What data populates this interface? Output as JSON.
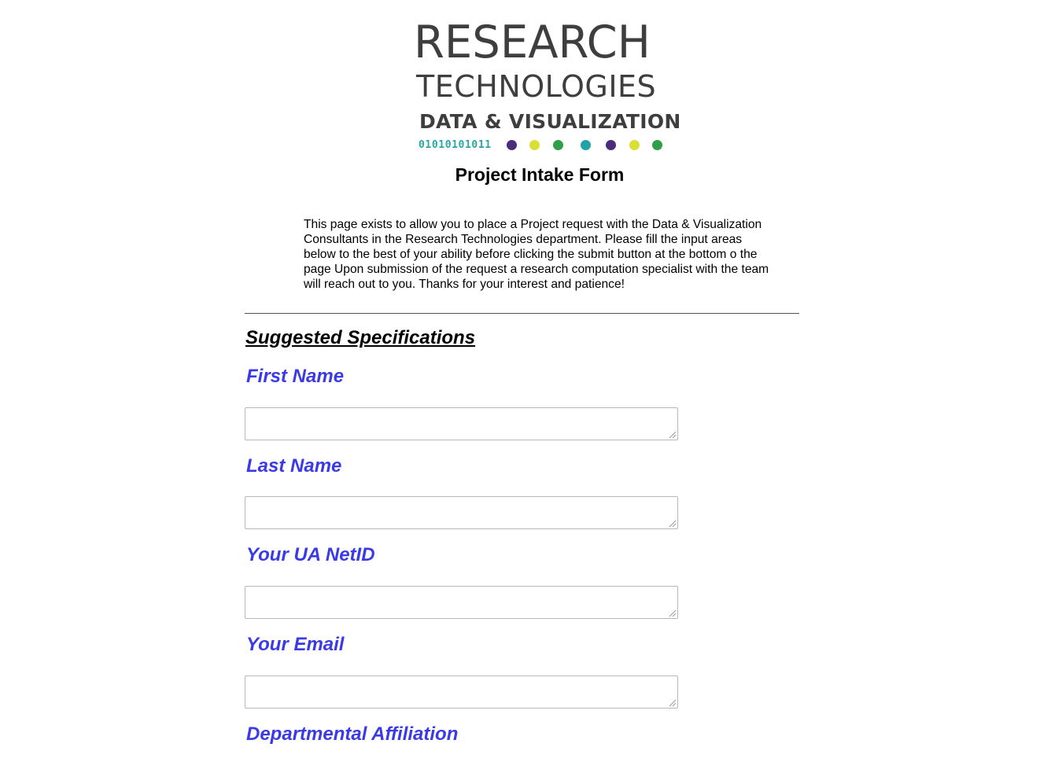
{
  "logo": {
    "line1": "RESEARCH",
    "line2": "TECHNOLOGIES",
    "line3": "DATA & VISUALIZATION",
    "binary": "01010101011",
    "text_color": "#3e3e3e",
    "binary_color": "#2aa6a6",
    "dot_colors": [
      "#4a2d7a",
      "#d9e033",
      "#2e9e48",
      "#20a3a8",
      "#4a2d7a",
      "#d9e033",
      "#2e9e48"
    ]
  },
  "form_title": "Project Intake Form",
  "intro": "This page exists to allow you to place a Project request with the Data & Visualization Consultants in the Research Technologies department. Please fill the input areas below to the best of your ability before clicking the submit button at the bottom o the page Upon submission of the request a research computation specialist with the team will reach out to you. Thanks for your interest and patience!",
  "section_heading": "Suggested Specifications",
  "label_color": "#3a3ae6",
  "fields": [
    {
      "label": "First Name",
      "value": ""
    },
    {
      "label": "Last Name",
      "value": ""
    },
    {
      "label": "Your UA NetID",
      "value": ""
    },
    {
      "label": "Your Email",
      "value": ""
    },
    {
      "label": "Departmental Affiliation",
      "value": ""
    }
  ]
}
